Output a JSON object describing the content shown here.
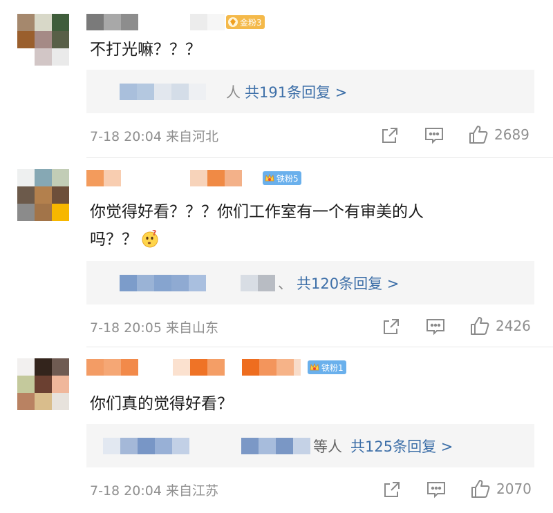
{
  "comments": [
    {
      "badge_text": "金粉3",
      "badge_type": "gold",
      "text": "不打光嘛？？？",
      "reply_tail": "人",
      "reply_link": "共191条回复 >",
      "meta": "7-18 20:04 来自河北",
      "likes": "2689"
    },
    {
      "badge_text": "铁粉5",
      "badge_type": "iron",
      "text_line1": "你觉得好看？？？你们工作室有一个有审美的人",
      "text_line2": "吗？？",
      "emoji": "thinking-face",
      "reply_tail": "、",
      "reply_link": "共120条回复 >",
      "meta": "7-18 20:05 来自山东",
      "likes": "2426"
    },
    {
      "badge_text": "铁粉1",
      "badge_type": "iron",
      "text": "你们真的觉得好看？",
      "reply_tail": "等人",
      "reply_link": "共125条回复 >",
      "meta": "7-18 20:04 来自江苏",
      "likes": "2070"
    }
  ],
  "icons": {
    "share": "share-icon",
    "comment": "comment-icon",
    "like": "like-icon"
  },
  "colors": {
    "link": "#3d6fa8",
    "meta": "#8f8f8f",
    "reply_bg": "#f5f5f5",
    "badge_gold": "#f4b94a",
    "badge_iron": "#6ab0ec"
  }
}
